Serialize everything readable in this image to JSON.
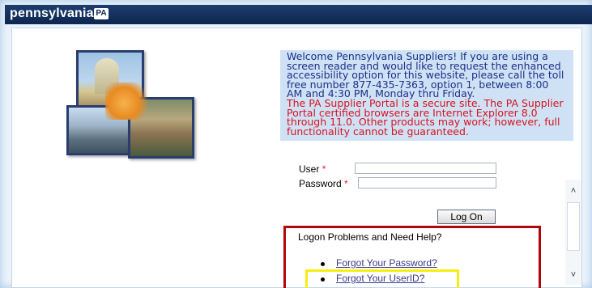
{
  "header": {
    "logo_text": "pennsylvania",
    "logo_badge": "PA"
  },
  "notice": {
    "welcome": "Welcome Pennsylvania Suppliers! If you are using a screen reader and would like to request the enhanced accessibility option for this website, please call the toll free number 877-435-7363, option 1, between 8:00 AM and 4:30 PM, Monday thru Friday.",
    "secure": "The PA Supplier Portal is a secure site. The PA Supplier Portal certified browsers are Internet Explorer 8.0 through 11.0. Other products may work; however, full functionality cannot be guaranteed."
  },
  "login": {
    "user_label": "User",
    "password_label": "Password",
    "required_marker": "*",
    "user_value": "",
    "password_value": "",
    "logon_button": "Log On"
  },
  "help": {
    "title": "Logon Problems and Need Help?",
    "links": [
      "Forgot Your Password?",
      "Forgot Your UserID?"
    ]
  },
  "colors": {
    "header": "#0e2650",
    "notice_bg": "#cfe2f5",
    "help_border": "#b0060c",
    "highlight": "#f6ee12"
  }
}
